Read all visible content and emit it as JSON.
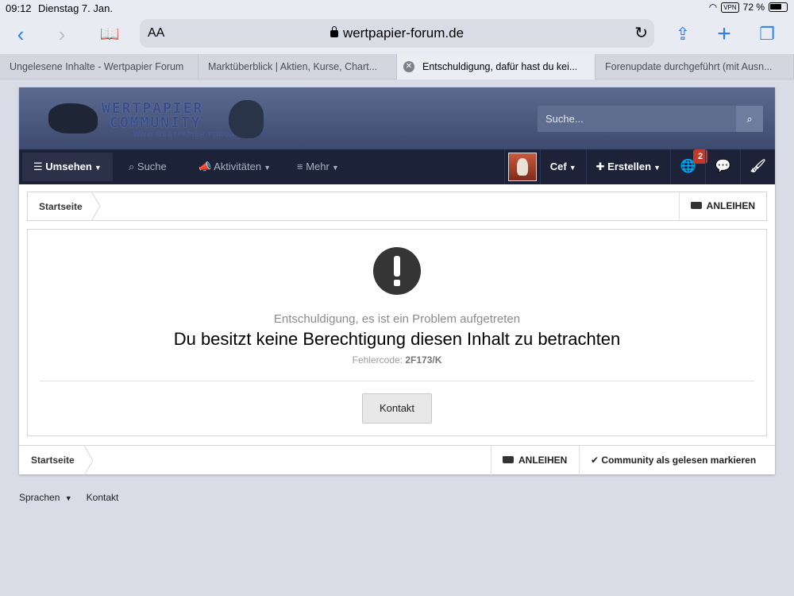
{
  "status_bar": {
    "time": "09:12",
    "date": "Dienstag 7. Jan.",
    "vpn": "VPN",
    "battery": "72 %"
  },
  "browser": {
    "aa": "AA",
    "url": "wertpapier-forum.de",
    "tabs": [
      {
        "label": "Ungelesene Inhalte - Wertpapier Forum"
      },
      {
        "label": "Marktüberblick | Aktien, Kurse, Chart..."
      },
      {
        "label": "Entschuldigung, dafür hast du kei..."
      },
      {
        "label": "Forenupdate durchgeführt (mit Ausn..."
      }
    ]
  },
  "header": {
    "logo_line1": "WERTPAPIER",
    "logo_line2": "COMMUNITY",
    "logo_sub": "WWW.WERTPAPIER-FORUM.DE",
    "search_placeholder": "Suche..."
  },
  "nav": {
    "umsehen": "Umsehen",
    "suche": "Suche",
    "aktivitaeten": "Aktivitäten",
    "mehr": "Mehr",
    "user": "Cef",
    "erstellen": "Erstellen",
    "notification_count": "2"
  },
  "breadcrumb": {
    "home": "Startseite",
    "right": "ANLEIHEN"
  },
  "error": {
    "subtitle": "Entschuldigung, es ist ein Problem aufgetreten",
    "title": "Du besitzt keine Berechtigung diesen Inhalt zu betrachten",
    "code_label": "Fehlercode:",
    "code": "2F173/K",
    "button": "Kontakt"
  },
  "bottom_breadcrumb": {
    "home": "Startseite",
    "anleihen": "ANLEIHEN",
    "mark_read": "Community als gelesen markieren"
  },
  "footer": {
    "sprachen": "Sprachen",
    "kontakt": "Kontakt"
  },
  "colors": {
    "accent": "#2a7ef7",
    "nav_bg": "#1c2338",
    "banner": "#4a5a80",
    "badge": "#c0392b"
  }
}
